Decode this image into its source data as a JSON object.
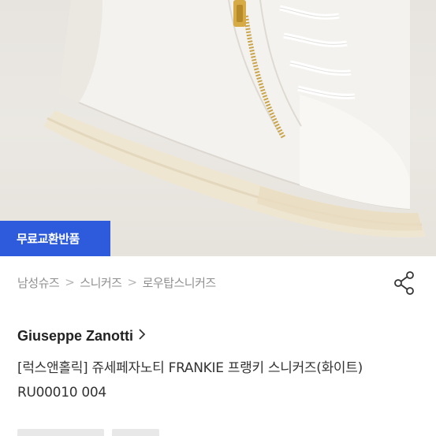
{
  "hero": {
    "image_label": "white leather sneaker with gold zipper",
    "badge": "무료교환반품"
  },
  "breadcrumb": {
    "items": [
      "남성슈즈",
      "스니커즈",
      "로우탑스니커즈"
    ],
    "separator": ">"
  },
  "actions": {
    "share_icon": "share-icon"
  },
  "product": {
    "brand": "Giuseppe Zanotti",
    "brand_chevron": ">",
    "title": "[럭스앤홀릭] 쥬세페자노티 FRANKIE 프랭키 스니커즈(화이트) RU00010 004"
  },
  "colors": {
    "badge_bg": "#2d5bdc",
    "breadcrumb_text": "#8f8f8f",
    "title_text": "#333333"
  }
}
